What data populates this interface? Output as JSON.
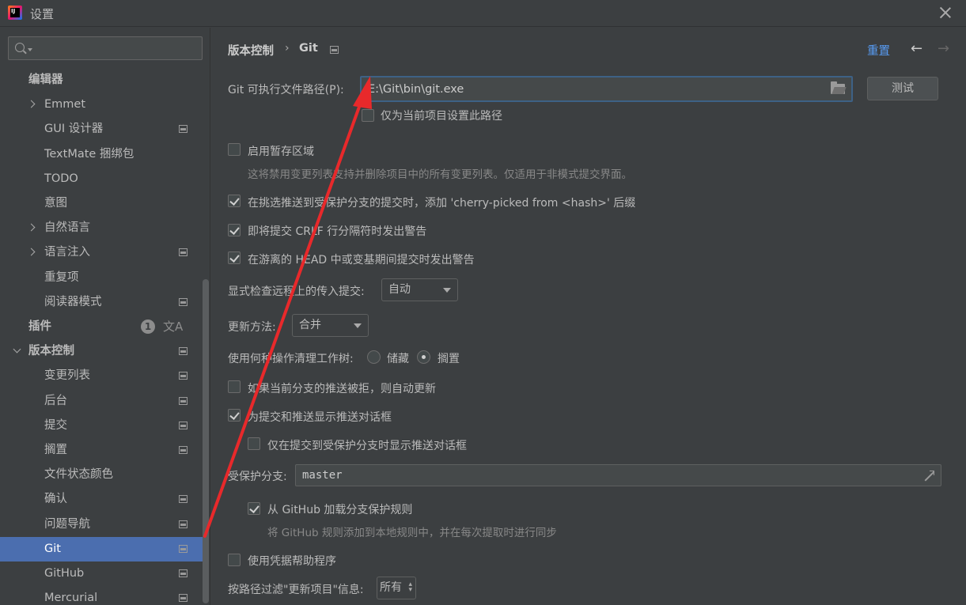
{
  "window": {
    "title": "设置",
    "app_icon": "intellij-idea-icon"
  },
  "sidebar": {
    "search_placeholder": "",
    "items": [
      {
        "label": "编辑器",
        "bold": true
      },
      {
        "label": "Emmet",
        "expandable": true
      },
      {
        "label": "GUI 设计器",
        "project_icon": true
      },
      {
        "label": "TextMate 捆绑包"
      },
      {
        "label": "TODO"
      },
      {
        "label": "意图"
      },
      {
        "label": "自然语言",
        "expandable": true
      },
      {
        "label": "语言注入",
        "expandable": true,
        "project_icon": true
      },
      {
        "label": "重复项"
      },
      {
        "label": "阅读器模式",
        "project_icon": true
      },
      {
        "label": "插件",
        "bold": true,
        "badge": "1",
        "translate_icon": "文A"
      },
      {
        "label": "版本控制",
        "bold": true,
        "expanded": true,
        "project_icon": true
      },
      {
        "label": "变更列表",
        "project_icon": true
      },
      {
        "label": "后台",
        "project_icon": true
      },
      {
        "label": "提交",
        "project_icon": true
      },
      {
        "label": "搁置",
        "project_icon": true
      },
      {
        "label": "文件状态颜色"
      },
      {
        "label": "确认",
        "project_icon": true
      },
      {
        "label": "问题导航",
        "project_icon": true
      },
      {
        "label": "Git",
        "selected": true,
        "project_icon": true
      },
      {
        "label": "GitHub",
        "project_icon": true
      },
      {
        "label": "Mercurial",
        "project_icon": true
      }
    ],
    "colors": {
      "selected": "#4b6eaf"
    }
  },
  "header": {
    "breadcrumb_parent": "版本控制",
    "breadcrumb_sep": "›",
    "breadcrumb_current": "Git",
    "reset": "重置",
    "back_arrow": "←",
    "forward_arrow": "→"
  },
  "git": {
    "path_label": "Git 可执行文件路径(P):",
    "path_value": "E:\\Git\\bin\\git.exe",
    "test_button": "测试",
    "project_only": "仅为当前项目设置此路径",
    "staging_area": "启用暂存区域",
    "staging_hint": "这将禁用变更列表支持并删除项目中的所有变更列表。仅适用于非模式提交界面。",
    "cherry_pick": "在挑选推送到受保护分支的提交时，添加 'cherry-picked from <hash>' 后缀",
    "crlf_warn": "即将提交 CRLF 行分隔符时发出警告",
    "detached_warn": "在游离的 HEAD 中或变基期间提交时发出警告",
    "incoming_label": "显式检查远程上的传入提交:",
    "incoming_value": "自动",
    "update_label": "更新方法:",
    "update_value": "合并",
    "clean_label": "使用何种操作清理工作树:",
    "clean_stash": "储藏",
    "clean_shelve": "搁置",
    "auto_update": "如果当前分支的推送被拒，则自动更新",
    "show_push": "为提交和推送显示推送对话框",
    "show_push_protected": "仅在提交到受保护分支时显示推送对话框",
    "protected_label": "受保护分支:",
    "protected_value": "master",
    "load_github": "从 GitHub 加载分支保护规则",
    "load_github_hint": "将 GitHub 规则添加到本地规则中，并在每次提取时进行同步",
    "credential_helper": "使用凭据帮助程序",
    "filter_label": "按路径过滤\"更新项目\"信息:",
    "filter_value": "所有"
  }
}
